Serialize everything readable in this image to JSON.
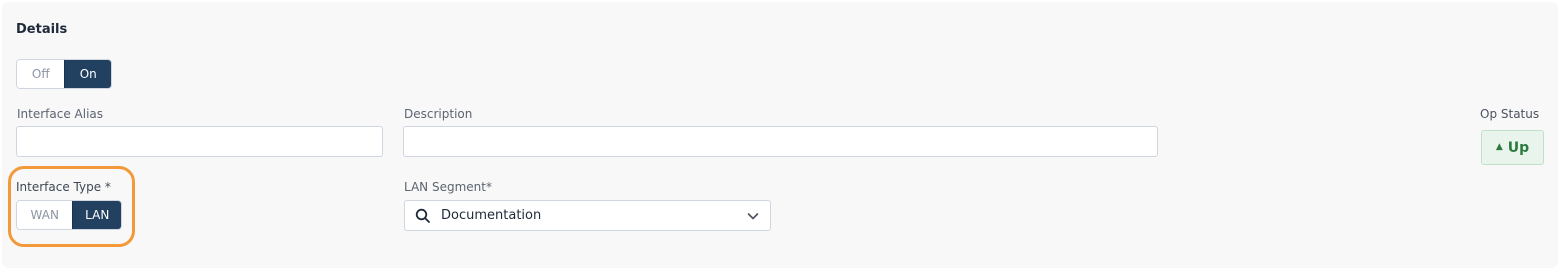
{
  "details": {
    "title": "Details",
    "enabled_toggle": {
      "off_label": "Off",
      "on_label": "On",
      "selected": "On"
    }
  },
  "interface_alias": {
    "label": "Interface Alias",
    "value": ""
  },
  "description": {
    "label": "Description",
    "value": ""
  },
  "op_status": {
    "label": "Op Status",
    "value": "Up",
    "color": "#2d7a3f"
  },
  "interface_type": {
    "label": "Interface Type *",
    "wan_label": "WAN",
    "lan_label": "LAN",
    "selected": "LAN"
  },
  "lan_segment": {
    "label": "LAN Segment*",
    "value": "Documentation"
  },
  "colors": {
    "accent": "#22405f",
    "highlight": "#f29a3a"
  }
}
